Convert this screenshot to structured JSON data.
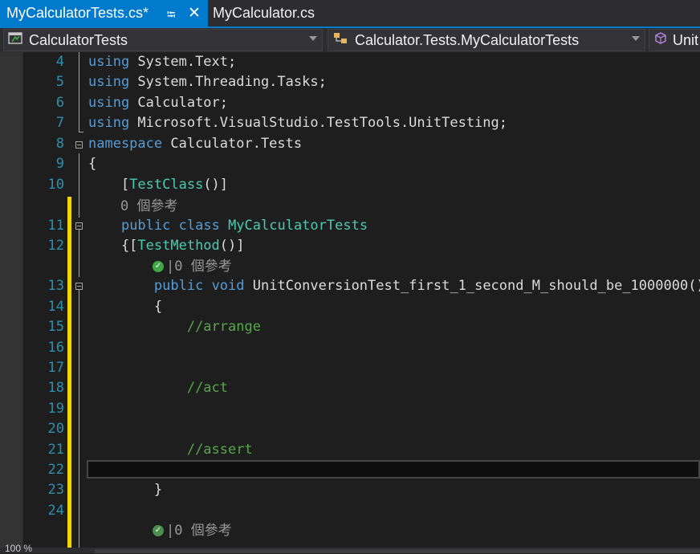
{
  "tabs": [
    {
      "label": "MyCalculatorTests.cs*",
      "active": true,
      "pinned_icon": "pin-icon",
      "close_icon": "close-icon"
    },
    {
      "label": "MyCalculator.cs",
      "active": false
    }
  ],
  "navbar": {
    "project": {
      "label": "CalculatorTests",
      "icon": "test-project-icon"
    },
    "type": {
      "label": "Calculator.Tests.MyCalculatorTests",
      "icon": "class-icon"
    },
    "member": {
      "label": "Unit",
      "icon": "method-cube-icon"
    }
  },
  "editor": {
    "lines": [
      {
        "num": "4",
        "code": [
          {
            "t": "kw",
            "v": "using"
          },
          {
            "t": "pl",
            "v": " System.Text;"
          }
        ]
      },
      {
        "num": "5",
        "code": [
          {
            "t": "kw",
            "v": "using"
          },
          {
            "t": "pl",
            "v": " System.Threading.Tasks;"
          }
        ]
      },
      {
        "num": "6",
        "code": [
          {
            "t": "kw",
            "v": "using"
          },
          {
            "t": "pl",
            "v": " Calculator;"
          }
        ]
      },
      {
        "num": "7",
        "code": [
          {
            "t": "kw",
            "v": "using"
          },
          {
            "t": "pl",
            "v": " Microsoft.VisualStudio.TestTools.UnitTesting;"
          }
        ]
      },
      {
        "num": "8",
        "code": [
          {
            "t": "kw",
            "v": "namespace"
          },
          {
            "t": "pl",
            "v": " Calculator.Tests"
          }
        ]
      },
      {
        "num": "9",
        "code": [
          {
            "t": "pl",
            "v": "{"
          }
        ]
      },
      {
        "num": "10",
        "code": [
          {
            "t": "pl",
            "v": "    ["
          },
          {
            "t": "ty",
            "v": "TestClass"
          },
          {
            "t": "pl",
            "v": "()]"
          }
        ]
      },
      {
        "num": "11",
        "code": [
          {
            "t": "pl",
            "v": "    "
          },
          {
            "t": "kw",
            "v": "public"
          },
          {
            "t": "pl",
            "v": " "
          },
          {
            "t": "kw",
            "v": "class"
          },
          {
            "t": "pl",
            "v": " "
          },
          {
            "t": "ty",
            "v": "MyCalculatorTests"
          }
        ]
      },
      {
        "num": "12",
        "code": [
          {
            "t": "pl",
            "v": "    {["
          },
          {
            "t": "ty",
            "v": "TestMethod"
          },
          {
            "t": "pl",
            "v": "()]"
          }
        ]
      },
      {
        "num": "13",
        "code": [
          {
            "t": "pl",
            "v": "        "
          },
          {
            "t": "kw",
            "v": "public"
          },
          {
            "t": "pl",
            "v": " "
          },
          {
            "t": "kw",
            "v": "void"
          },
          {
            "t": "pl",
            "v": " UnitConversionTest_first_1_second_M_should_be_1000000()"
          }
        ]
      },
      {
        "num": "14",
        "code": [
          {
            "t": "pl",
            "v": "        {"
          }
        ]
      },
      {
        "num": "15",
        "code": [
          {
            "t": "pl",
            "v": "            "
          },
          {
            "t": "cm",
            "v": "//arrange"
          }
        ]
      },
      {
        "num": "16",
        "code": []
      },
      {
        "num": "17",
        "code": []
      },
      {
        "num": "18",
        "code": [
          {
            "t": "pl",
            "v": "            "
          },
          {
            "t": "cm",
            "v": "//act"
          }
        ]
      },
      {
        "num": "19",
        "code": []
      },
      {
        "num": "20",
        "code": []
      },
      {
        "num": "21",
        "code": [
          {
            "t": "pl",
            "v": "            "
          },
          {
            "t": "cm",
            "v": "//assert"
          }
        ]
      },
      {
        "num": "22",
        "code": []
      },
      {
        "num": "23",
        "code": [
          {
            "t": "pl",
            "v": "        }"
          }
        ]
      },
      {
        "num": "24",
        "code": []
      }
    ],
    "codelens_class": "0 個參考",
    "codelens_method": "|0 個參考",
    "codelens_next": "|0 個參考"
  },
  "status": {
    "zoom": "100 %"
  },
  "colors": {
    "accent": "#007acc",
    "change_bar": "#f2d600"
  }
}
